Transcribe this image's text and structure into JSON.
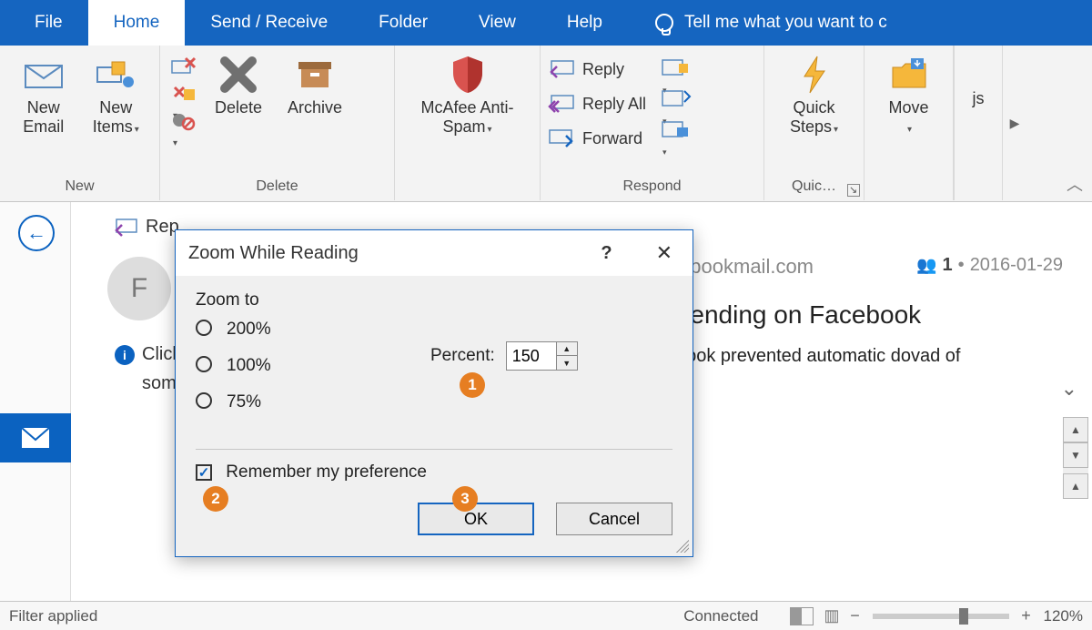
{
  "ribbon_tabs": {
    "file": "File",
    "home": "Home",
    "send_receive": "Send / Receive",
    "folder": "Folder",
    "view": "View",
    "help": "Help",
    "tell_me": "Tell me what you want to c"
  },
  "ribbon": {
    "new_group_label": "New",
    "new_email": "New\nEmail",
    "new_items": "New\nItems",
    "delete_group_label": "Delete",
    "delete": "Delete",
    "archive": "Archive",
    "mcafee": "McAfee Anti-\nSpam",
    "respond_group_label": "Respond",
    "reply": "Reply",
    "reply_all": "Reply All",
    "forward": "Forward",
    "quick_steps": "Quick\nSteps",
    "quick_label": "Quic…",
    "move": "Move",
    "tags_stub": "js"
  },
  "preview": {
    "reply": "Rep",
    "avatar_initial": "F",
    "info_click": "Click",
    "info_som": "som",
    "email_source": "ebookmail.com",
    "people_count": "1",
    "date": "2016-01-29",
    "subject": "Trending on Facebook",
    "note": "utlook prevented automatic dovad of"
  },
  "dialog": {
    "title": "Zoom While Reading",
    "zoom_to": "Zoom to",
    "opt_200": "200%",
    "opt_100": "100%",
    "opt_75": "75%",
    "percent_label": "Percent:",
    "percent_value": "150",
    "remember": "Remember my preference",
    "ok": "OK",
    "cancel": "Cancel",
    "callout1": "1",
    "callout2": "2",
    "callout3": "3"
  },
  "status": {
    "filter": "Filter applied",
    "connected": "Connected",
    "zoom": "120%"
  }
}
